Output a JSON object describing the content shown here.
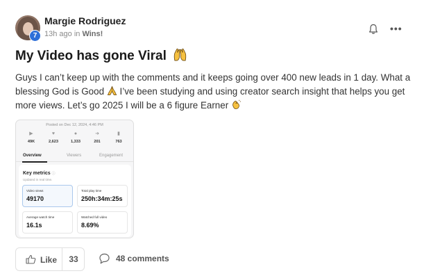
{
  "post": {
    "author": "Margie Rodriguez",
    "level": "7",
    "time_prefix": "13h ago in",
    "category": "Wins!",
    "title": "My Video has gone Viral",
    "title_emoji": "raising-hands-emoji",
    "body_part1": "Guys I can’t keep up with the comments and it keeps going over 400 new leads in 1 day. What a blessing God is Good",
    "body_part2": "I’ve been studying and using creator search insight that helps you get more views. Let’s go 2025 I will be a 6 figure Earner",
    "body_emojis": [
      "folded-hands-emoji",
      "clapping-hands-emoji"
    ]
  },
  "embed": {
    "posted": "Posted on Dec 12, 2024, 4:46 PM",
    "stats": [
      {
        "icon": "play-icon",
        "value": "49K"
      },
      {
        "icon": "heart-icon",
        "value": "2,623"
      },
      {
        "icon": "comment-icon",
        "value": "1,333"
      },
      {
        "icon": "share-icon",
        "value": "201"
      },
      {
        "icon": "bookmark-icon",
        "value": "763"
      }
    ],
    "tabs": [
      "Overview",
      "Viewers",
      "Engagement"
    ],
    "metrics_title": "Key metrics",
    "metrics_subtitle": "Updated in real time.",
    "metrics": [
      {
        "label": "Video views",
        "value": "49170"
      },
      {
        "label": "Total play time",
        "value": "250h:34m:25s"
      },
      {
        "label": "Average watch time",
        "value": "16.1s"
      },
      {
        "label": "Watched full video",
        "value": "8.69%"
      }
    ]
  },
  "footer": {
    "like_label": "Like",
    "like_count": "33",
    "comments_label": "48 comments"
  },
  "colors": {
    "level_badge": "#2e6fd8",
    "emoji_yellow": "#f6c141"
  }
}
